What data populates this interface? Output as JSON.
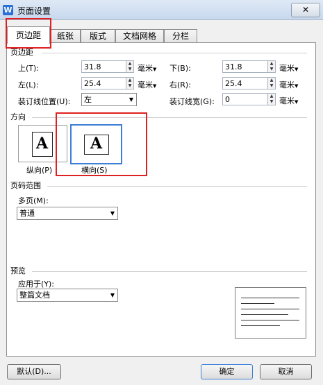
{
  "window": {
    "title": "页面设置",
    "app_icon_letter": "W",
    "close_label": "✕"
  },
  "tabs": [
    {
      "label": "页边距",
      "active": true
    },
    {
      "label": "纸张"
    },
    {
      "label": "版式"
    },
    {
      "label": "文档网格"
    },
    {
      "label": "分栏"
    }
  ],
  "margins": {
    "section_label": "页边距",
    "top_label": "上(T):",
    "top_value": "31.8",
    "bottom_label": "下(B):",
    "bottom_value": "31.8",
    "left_label": "左(L):",
    "left_value": "25.4",
    "right_label": "右(R):",
    "right_value": "25.4",
    "gutter_pos_label": "装订线位置(U):",
    "gutter_pos_value": "左",
    "gutter_width_label": "装订线宽(G):",
    "gutter_width_value": "0",
    "unit": "毫米"
  },
  "orientation": {
    "section_label": "方向",
    "portrait_label": "纵向(P)",
    "landscape_label": "横向(S)",
    "icon_letter": "A",
    "selected": "landscape"
  },
  "page_range": {
    "section_label": "页码范围",
    "multi_label": "多页(M):",
    "multi_value": "普通"
  },
  "preview": {
    "section_label": "预览",
    "apply_label": "应用于(Y):",
    "apply_value": "整篇文档"
  },
  "buttons": {
    "default": "默认(D)...",
    "ok": "确定",
    "cancel": "取消"
  },
  "colors": {
    "highlight": "#e02020",
    "selected_border": "#3c7fd6"
  }
}
